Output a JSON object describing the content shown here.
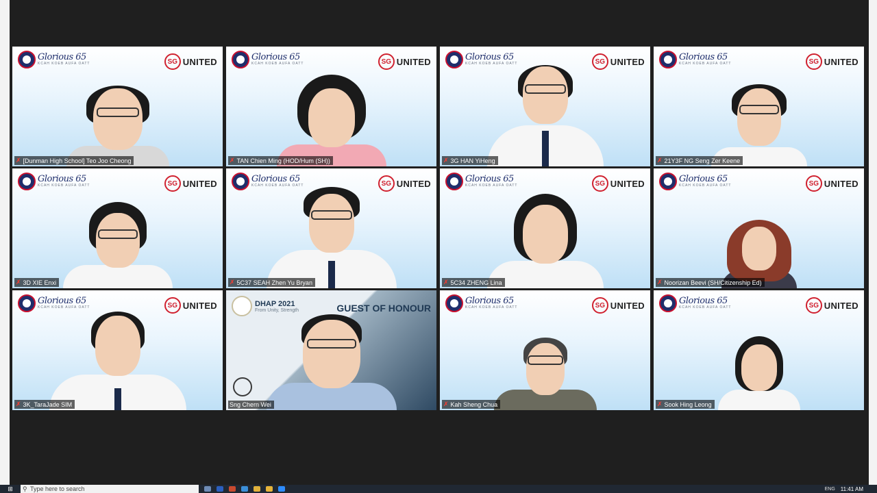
{
  "brand": {
    "glorious_script": "Glorious 65",
    "glorious_sub": "KCAH KOEB AUFA OATT",
    "sg_circle": "SG",
    "sg_text": "UNITED"
  },
  "goh_tile": {
    "dhap_title": "DHAP 2021",
    "dhap_subtitle": "From Unity, Strength",
    "banner": "GUEST OF HONOUR"
  },
  "participants": [
    {
      "name": "[Dunman High School] Teo Joo Cheong"
    },
    {
      "name": "TAN Chien Ming (HOD/Hum (SH))"
    },
    {
      "name": "3G HAN YiHeng"
    },
    {
      "name": "21Y3F NG Seng Zer Keene"
    },
    {
      "name": "3D XIE Enxi"
    },
    {
      "name": "5C37 SEAH Zhen Yu Bryan"
    },
    {
      "name": "5C34 ZHENG Lina"
    },
    {
      "name": "Noorizan Beevi (SH/Citizenship Ed)"
    },
    {
      "name": "3K_TaraJade SIM"
    },
    {
      "name": "Sng Chern Wei"
    },
    {
      "name": "Kah Sheng Chua"
    },
    {
      "name": "Sook Hing Leong"
    }
  ],
  "taskbar": {
    "search_placeholder": "Type here to search",
    "lang": "ENG",
    "time": "11:41 AM"
  },
  "icons": {
    "mic": "muted-mic-icon",
    "windows": "windows-start-icon",
    "search": "search-icon"
  }
}
